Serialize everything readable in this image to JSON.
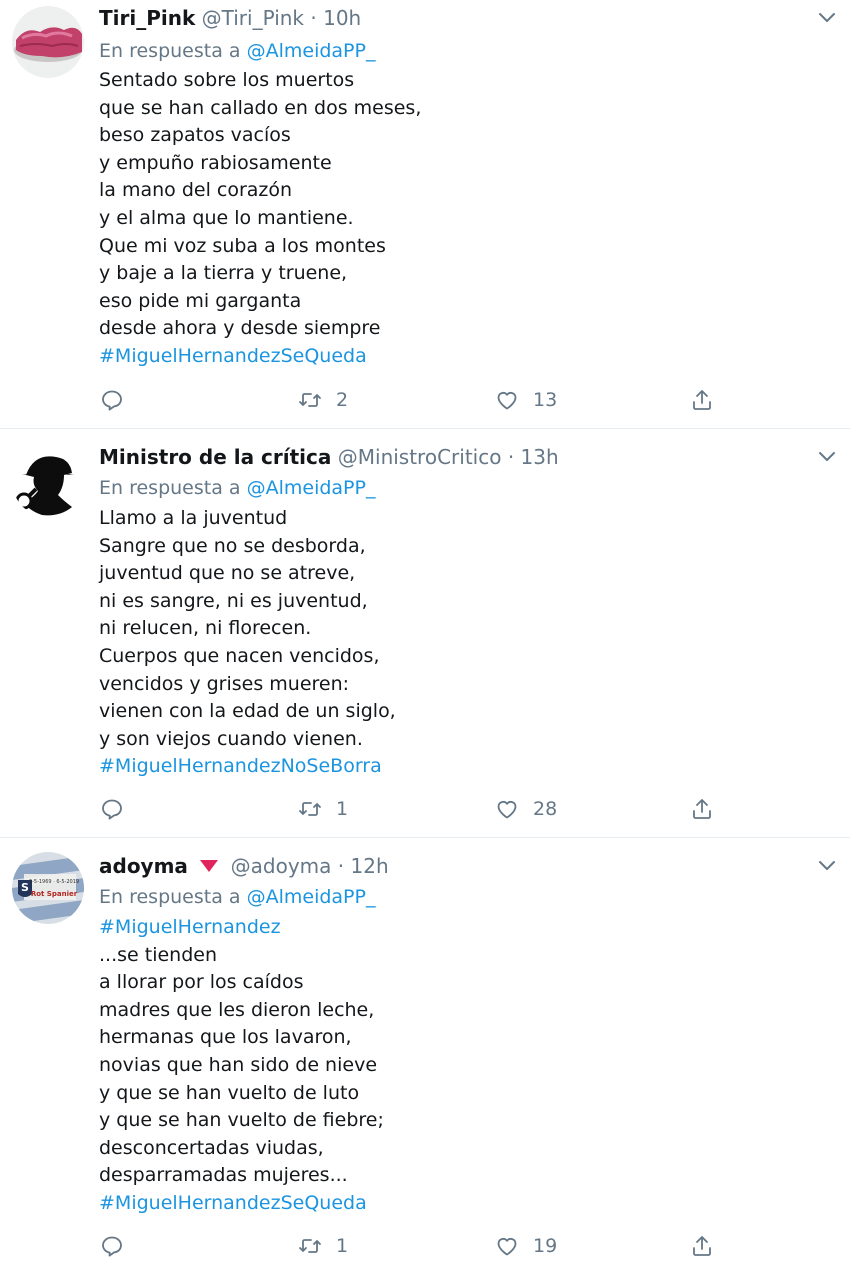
{
  "tweets": [
    {
      "name": "Tiri_Pink",
      "handle": "@Tiri_Pink",
      "separator": "·",
      "time": "10h",
      "reply_prefix": "En respuesta a",
      "reply_mention": "@AlmeidaPP_",
      "lines": [
        "Sentado sobre los muertos",
        "que se han callado en dos meses,",
        "beso zapatos vacíos",
        "y empuño rabiosamente",
        "la mano del corazón",
        "y el alma que lo mantiene.",
        "Que mi voz suba a los montes",
        "y baje a la tierra y truene,",
        "eso pide mi garganta",
        "desde ahora y desde siempre"
      ],
      "hashtag": "#MiguelHernandezSeQueda",
      "retweets": "2",
      "likes": "13"
    },
    {
      "name": "Ministro de la crítica",
      "handle": "@MinistroCritico",
      "separator": "·",
      "time": "13h",
      "reply_prefix": "En respuesta a",
      "reply_mention": "@AlmeidaPP_",
      "lines": [
        "Llamo a la juventud",
        "Sangre que no se desborda,",
        "juventud que no se atreve,",
        "ni es sangre, ni es juventud,",
        "ni relucen, ni florecen.",
        "Cuerpos que nacen vencidos,",
        "vencidos y grises mueren:",
        "vienen con la edad de un siglo,",
        "y son viejos cuando vienen."
      ],
      "hashtag": "#MiguelHernandezNoSeBorra",
      "retweets": "1",
      "likes": "28"
    },
    {
      "name": "adoyma",
      "handle": "@adoyma",
      "separator": "·",
      "time": "12h",
      "reply_prefix": "En respuesta a",
      "reply_mention": "@AlmeidaPP_",
      "top_hashtag": "#MiguelHernandez",
      "lines": [
        "...se tienden",
        "a llorar por los caídos",
        "madres que les dieron leche,",
        "hermanas que los lavaron,",
        "novias que han sido de nieve",
        "y que se han vuelto de luto",
        "y que se han vuelto de fiebre;",
        "desconcertadas viudas,",
        "desparramadas mujeres..."
      ],
      "hashtag": "#MiguelHernandezSeQueda",
      "retweets": "1",
      "likes": "19",
      "avatar_text_1": "6-5-1969 · 6-5-2019",
      "avatar_text_2": "Rot Spanier"
    }
  ],
  "colors": {
    "link": "#1b95e0",
    "secondary": "#657786",
    "text": "#14171a",
    "divider": "#e6ecf0",
    "heart_badge": "#e0245e"
  },
  "icons": [
    "reply-icon",
    "retweet-icon",
    "like-icon",
    "share-icon",
    "caret-down-icon"
  ]
}
